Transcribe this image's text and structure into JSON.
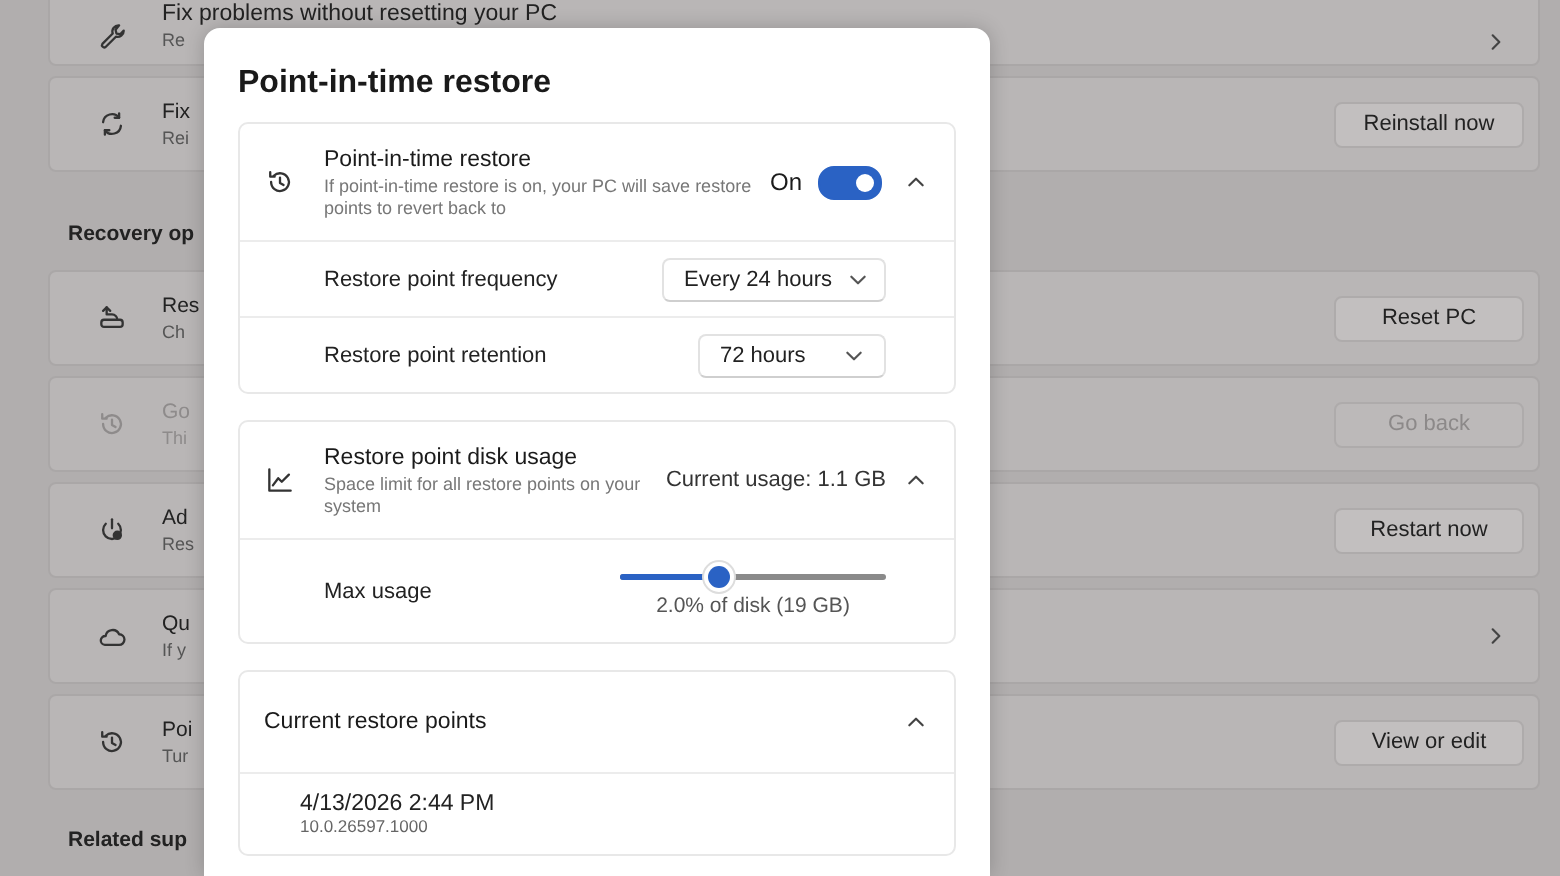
{
  "settings_page": {
    "top_items": [
      {
        "title": "Fix problems without resetting your PC",
        "subtitle": "Re",
        "disabled": false,
        "action": {
          "kind": "chevron"
        }
      },
      {
        "title": "Fix",
        "subtitle": "Rei",
        "disabled": false,
        "action": {
          "kind": "button",
          "label": "Reinstall now"
        }
      }
    ],
    "section_title": "Recovery op",
    "items": [
      {
        "title": "Res",
        "subtitle": "Ch",
        "disabled": false,
        "action": {
          "kind": "button",
          "label": "Reset PC"
        }
      },
      {
        "title": "Go",
        "subtitle": "Thi",
        "disabled": true,
        "action": {
          "kind": "button",
          "label": "Go back"
        }
      },
      {
        "title": "Ad",
        "subtitle": "Res",
        "disabled": false,
        "action": {
          "kind": "button",
          "label": "Restart now"
        }
      },
      {
        "title": "Qu",
        "subtitle": "If y",
        "disabled": false,
        "action": {
          "kind": "chevron"
        }
      },
      {
        "title": "Poi",
        "subtitle": "Tur",
        "disabled": false,
        "action": {
          "kind": "button",
          "label": "View or edit"
        }
      }
    ],
    "footer_heading": "Related sup"
  },
  "dialog": {
    "title": "Point-in-time restore",
    "sections": [
      {
        "kind": "toggle",
        "title": "Point-in-time restore",
        "description": "If point-in-time restore is on, your PC will save restore points to revert back to",
        "state_label": "On",
        "on": true,
        "expanded": true,
        "rows": [
          {
            "kind": "dropdown",
            "label": "Restore point frequency",
            "value": "Every 24 hours"
          },
          {
            "kind": "dropdown",
            "label": "Restore point retention",
            "value": "72 hours"
          }
        ]
      },
      {
        "kind": "usage",
        "title": "Restore point disk usage",
        "description": "Space limit for all restore points on your system",
        "value": "Current usage: 1.1 GB",
        "expanded": true,
        "rows": [
          {
            "kind": "slider",
            "label": "Max usage",
            "level": 0.37,
            "reading": "2.0% of disk (19 GB)"
          }
        ]
      },
      {
        "kind": "list",
        "title": "Current restore points",
        "expanded": true,
        "entries": [
          {
            "title": "4/13/2026 2:44 PM",
            "subtitle": "10.0.26597.1000"
          }
        ]
      }
    ]
  }
}
